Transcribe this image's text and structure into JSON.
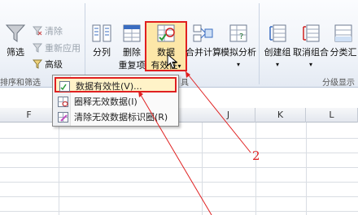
{
  "ribbon": {
    "sort_filter": {
      "filter_label": "筛选",
      "clear_label": "清除",
      "reapply_label": "重新应用",
      "advanced_label": "高级",
      "group_label": "排序和筛选"
    },
    "data_tools": {
      "text_to_columns_label": "分列",
      "remove_dup_line1": "删除",
      "remove_dup_line2": "重复项",
      "data_validation_line1": "数据",
      "data_validation_line2": "有效性",
      "consolidate_label": "合并计算",
      "what_if_label": "模拟分析",
      "group_label": "具"
    },
    "outline": {
      "group_label": "创建组",
      "ungroup_label": "取消组合",
      "subtotal_label": "分类汇",
      "group_title": "分级显示"
    }
  },
  "columns": [
    "F",
    "J",
    "K",
    "L"
  ],
  "context_menu": {
    "items": [
      {
        "label": "数据有效性(V)..."
      },
      {
        "label": "圈释无效数据(I)"
      },
      {
        "label": "清除无效数据标识圈(R)"
      }
    ]
  },
  "annotation": {
    "number": "2",
    "color": "#e02020"
  }
}
